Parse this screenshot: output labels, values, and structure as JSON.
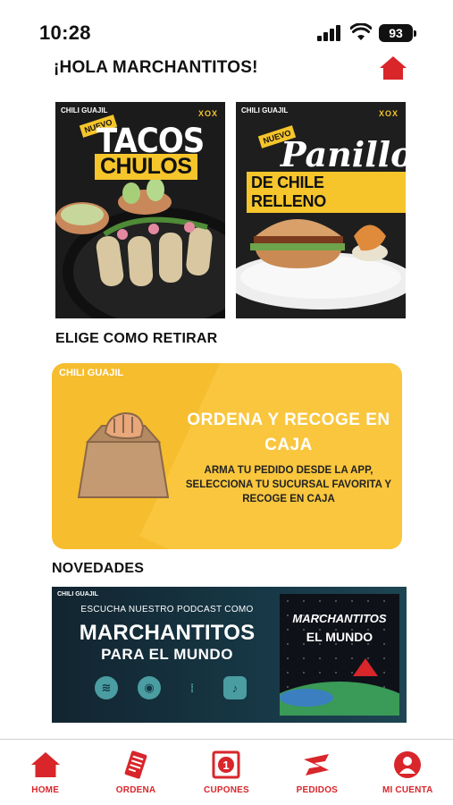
{
  "status_bar": {
    "time": "10:28",
    "battery": "93",
    "icons": [
      "signal-icon",
      "wifi-icon",
      "battery-icon"
    ]
  },
  "header": {
    "greeting": "¡HOLA MARCHANTITOS!",
    "home_icon": "home-icon"
  },
  "promos": [
    {
      "brand": "CHILI GUAJIL",
      "deco": "XOX",
      "badge": "NUEVO",
      "title_top": "TACOS",
      "title_bottom": "CHULOS"
    },
    {
      "brand": "CHILI GUAJIL",
      "deco": "XOX",
      "badge": "NUEVO",
      "title_top": "Panillo",
      "title_bottom": "DE CHILE RELLENO"
    }
  ],
  "pickup_section": {
    "title": "ELIGE COMO RETIRAR",
    "card": {
      "brand": "CHILI GUAJIL",
      "title": "ORDENA Y RECOGE EN CAJA",
      "description": "ARMA TU PEDIDO DESDE LA APP, SELECCIONA TU SUCURSAL FAVORITA Y RECOGE EN CAJA"
    }
  },
  "news_section": {
    "title": "NOVEDADES",
    "podcast": {
      "brand": "CHILI GUAJIL",
      "subtitle": "ESCUCHA NUESTRO PODCAST COMO",
      "title": "MARCHANTITOS",
      "title_line2": "PARA EL MUNDO",
      "cover_title": "MARCHANTITOS",
      "cover_subtitle": "EL MUNDO",
      "platform_icons": [
        "spotify-icon",
        "apple-podcasts-icon",
        "google-podcasts-icon",
        "amazon-music-icon"
      ]
    }
  },
  "bottom_nav": {
    "accent": "#d8262b",
    "items": [
      {
        "label": "HOME",
        "icon": "home-icon"
      },
      {
        "label": "ORDENA",
        "icon": "order-icon"
      },
      {
        "label": "CUPONES",
        "icon": "coupon-icon"
      },
      {
        "label": "PEDIDOS",
        "icon": "orders-icon"
      },
      {
        "label": "MI CUENTA",
        "icon": "account-icon"
      }
    ]
  }
}
